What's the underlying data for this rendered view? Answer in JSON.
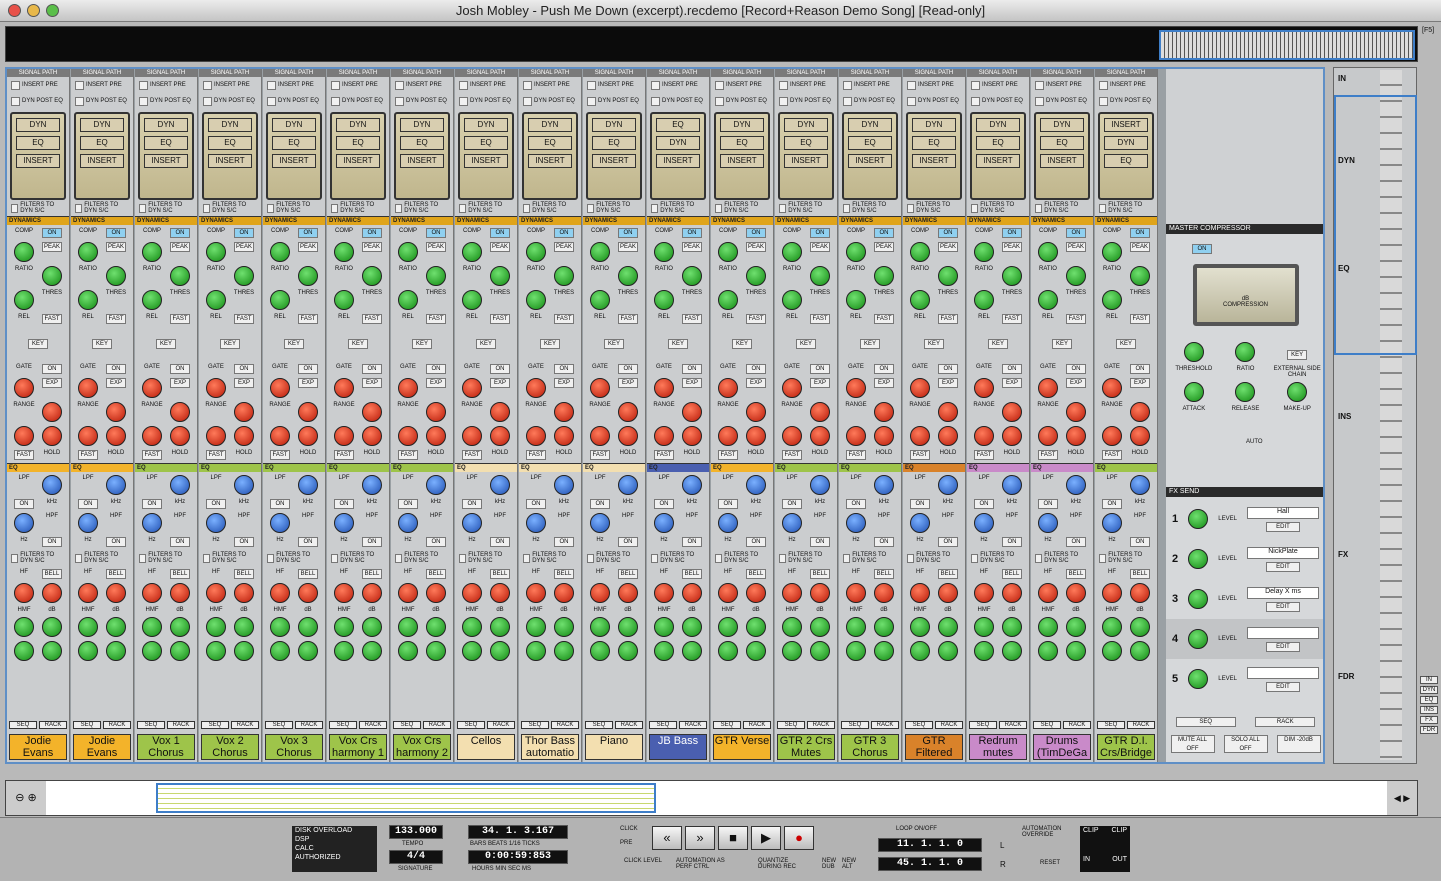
{
  "window": {
    "title": "Josh Mobley - Push Me Down (excerpt).recdemo [Record+Reason Demo Song] [Read-only]",
    "fs_label": "[F5]"
  },
  "channel_labels": {
    "signal_path": "SIGNAL PATH",
    "insert_pre": "INSERT PRE",
    "dyn_post_eq": "DYN POST EQ",
    "filters_to_dyn": "FILTERS TO DYN S/C",
    "dynamics": "DYNAMICS",
    "eq": "EQ",
    "comp": "COMP",
    "on": "ON",
    "peak": "PEAK",
    "ratio": "RATIO",
    "thres": "THRES",
    "rel": "REL",
    "fast": "FAST",
    "key": "KEY",
    "gate": "GATE",
    "exp": "EXP",
    "range": "RANGE",
    "hold": "HOLD",
    "lpf": "LPF",
    "hpf": "HPF",
    "khz": "kHz",
    "hz": "Hz",
    "hf": "HF",
    "bell": "BELL",
    "hmf": "HMF",
    "db": "dB",
    "seq": "SEQ",
    "rack": "RACK"
  },
  "channels": [
    {
      "name": "Jodie Evans",
      "color": "#f3b32a",
      "order": [
        "DYN",
        "EQ",
        "INSERT"
      ]
    },
    {
      "name": "Jodie Evans",
      "color": "#f3b32a",
      "order": [
        "DYN",
        "EQ",
        "INSERT"
      ]
    },
    {
      "name": "Vox 1 Chorus",
      "color": "#9ec44a",
      "order": [
        "DYN",
        "EQ",
        "INSERT"
      ]
    },
    {
      "name": "Vox 2 Chorus",
      "color": "#9ec44a",
      "order": [
        "DYN",
        "EQ",
        "INSERT"
      ]
    },
    {
      "name": "Vox 3 Chorus",
      "color": "#9ec44a",
      "order": [
        "DYN",
        "EQ",
        "INSERT"
      ]
    },
    {
      "name": "Vox Crs harmony 1",
      "color": "#9ec44a",
      "order": [
        "DYN",
        "EQ",
        "INSERT"
      ]
    },
    {
      "name": "Vox Crs harmony 2",
      "color": "#9ec44a",
      "order": [
        "DYN",
        "EQ",
        "INSERT"
      ]
    },
    {
      "name": "Cellos",
      "color": "#f3dfb0",
      "order": [
        "DYN",
        "EQ",
        "INSERT"
      ]
    },
    {
      "name": "Thor Bass automatio",
      "color": "#f3dfb0",
      "order": [
        "DYN",
        "EQ",
        "INSERT"
      ]
    },
    {
      "name": "Piano",
      "color": "#f3dfb0",
      "order": [
        "DYN",
        "EQ",
        "INSERT"
      ]
    },
    {
      "name": "JB Bass",
      "color": "#4a5fb0",
      "order": [
        "EQ",
        "DYN",
        "INSERT"
      ]
    },
    {
      "name": "GTR Verse",
      "color": "#f3b32a",
      "order": [
        "DYN",
        "EQ",
        "INSERT"
      ]
    },
    {
      "name": "GTR 2 Crs Mutes",
      "color": "#9ec44a",
      "order": [
        "DYN",
        "EQ",
        "INSERT"
      ]
    },
    {
      "name": "GTR 3 Chorus",
      "color": "#9ec44a",
      "order": [
        "DYN",
        "EQ",
        "INSERT"
      ]
    },
    {
      "name": "GTR Filtered",
      "color": "#d9822a",
      "order": [
        "DYN",
        "EQ",
        "INSERT"
      ]
    },
    {
      "name": "Redrum mutes",
      "color": "#c98ac9",
      "order": [
        "DYN",
        "EQ",
        "INSERT"
      ]
    },
    {
      "name": "Drums (TimDeGa",
      "color": "#c98ac9",
      "order": [
        "DYN",
        "EQ",
        "INSERT"
      ]
    },
    {
      "name": "GTR D.I. Crs/Bridge",
      "color": "#9ec44a",
      "order": [
        "INSERT",
        "DYN",
        "EQ"
      ]
    }
  ],
  "master": {
    "title": "MASTER COMPRESSOR",
    "on": "ON",
    "db": "dB",
    "compression": "COMPRESSION",
    "threshold": "THRESHOLD",
    "ratio": "RATIO",
    "ext_side_chain": "EXTERNAL SIDE CHAIN",
    "key": "KEY",
    "attack": "ATTACK",
    "release": "RELEASE",
    "makeup": "MAKE-UP",
    "auto": "AUTO",
    "fx_send": "FX SEND",
    "level": "LEVEL",
    "edit": "EDIT",
    "sends": [
      {
        "n": "1",
        "name": "Hall"
      },
      {
        "n": "2",
        "name": "NickPlate"
      },
      {
        "n": "3",
        "name": "Delay X ms"
      },
      {
        "n": "4",
        "name": ""
      },
      {
        "n": "5",
        "name": ""
      }
    ],
    "seq": "SEQ",
    "rack": "RACK",
    "mute_all_off": "MUTE ALL OFF",
    "solo_all_off": "SOLO ALL OFF",
    "dim": "DIM -20dB"
  },
  "sidebar": {
    "in": "IN",
    "dyn": "DYN",
    "eq": "EQ",
    "ins": "INS",
    "fx": "FX",
    "fdr": "FDR",
    "buttons": [
      "IN",
      "DYN",
      "EQ",
      "INS",
      "FX",
      "FDR"
    ]
  },
  "transport": {
    "dsp": {
      "disk_overload": "DISK OVERLOAD",
      "dsp": "DSP",
      "calc": "CALC",
      "authorized": "AUTHORIZED"
    },
    "tempo": "133.000",
    "tempo_label": "TEMPO",
    "signature": "4/4",
    "signature_label": "SIGNATURE",
    "position": "34. 1. 3.167",
    "position_label": "BARS BEATS 1/16 TICKS",
    "time": "0:00:59:853",
    "time_label": "HOURS MIN SEC MS",
    "click": "CLICK",
    "pre": "PRE",
    "click_level": "CLICK LEVEL",
    "automation_perf": "AUTOMATION AS PERF CTRL",
    "quantize": "QUANTIZE DURING REC",
    "new_dub": "NEW DUB",
    "new_alt": "NEW ALT",
    "loop": "LOOP ON/OFF",
    "loop_left": "11. 1. 1. 0",
    "loop_right": "45. 1. 1. 0",
    "l": "L",
    "r": "R",
    "automation_override": "AUTOMATION OVERRIDE",
    "reset": "RESET",
    "clip": "CLIP",
    "in": "IN",
    "out": "OUT"
  },
  "colors": {
    "accent": "#3e7ec8",
    "section_header": "#e0a41a"
  }
}
